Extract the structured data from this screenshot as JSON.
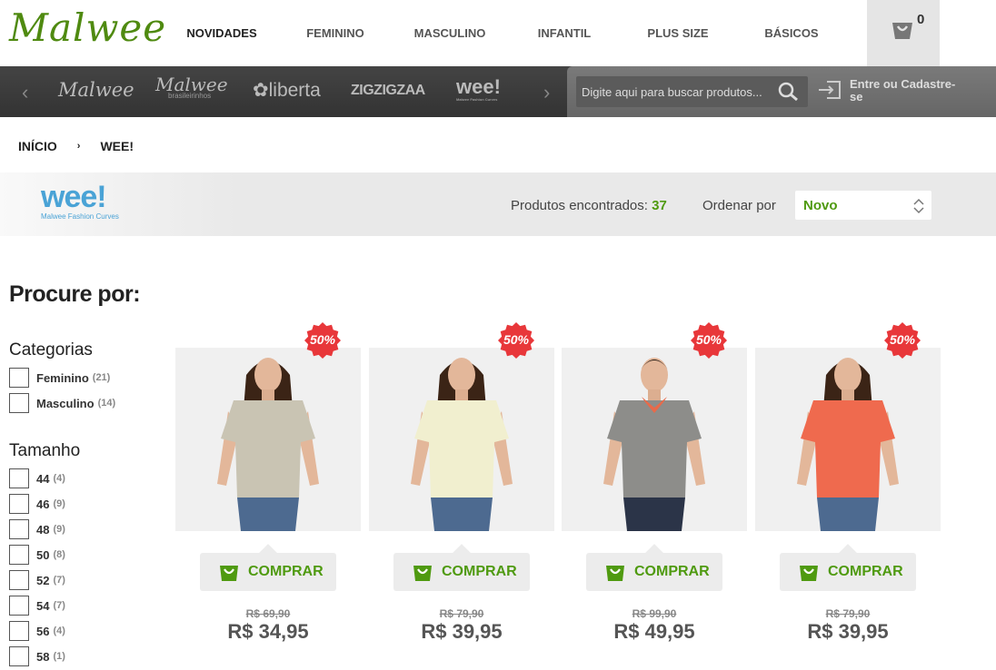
{
  "header": {
    "logo": "Malwee",
    "nav": [
      "NOVIDADES",
      "FEMININO",
      "MASCULINO",
      "INFANTIL",
      "PLUS SIZE",
      "BÁSICOS"
    ],
    "cart_count": "0"
  },
  "brands": {
    "items": [
      {
        "name": "Malwee"
      },
      {
        "name": "Malwee",
        "sub": "brasileirinhos"
      },
      {
        "name": "liberta",
        "sub": "Malwee"
      },
      {
        "name": "ZIGZIGZAA"
      },
      {
        "name": "wee!",
        "sub": "Malwee Fashion Curves"
      }
    ]
  },
  "search": {
    "placeholder": "Digite aqui para buscar produtos..."
  },
  "login": {
    "label": "Entre ou Cadastre-se"
  },
  "breadcrumb": {
    "home": "INÍCIO",
    "separator": "›",
    "current": "WEE!"
  },
  "brand_header": {
    "logo": "wee!",
    "tagline": "Malwee Fashion Curves"
  },
  "listing": {
    "found_label": "Produtos encontrados:",
    "found_count": "37",
    "order_label": "Ordenar por",
    "order_value": "Novo"
  },
  "filters": {
    "title": "Procure por:",
    "categories": {
      "title": "Categorias",
      "items": [
        {
          "label": "Feminino",
          "count": "(21)"
        },
        {
          "label": "Masculino",
          "count": "(14)"
        }
      ]
    },
    "sizes": {
      "title": "Tamanho",
      "items": [
        {
          "label": "44",
          "count": "(4)"
        },
        {
          "label": "46",
          "count": "(9)"
        },
        {
          "label": "48",
          "count": "(9)"
        },
        {
          "label": "50",
          "count": "(8)"
        },
        {
          "label": "52",
          "count": "(7)"
        },
        {
          "label": "54",
          "count": "(7)"
        },
        {
          "label": "56",
          "count": "(4)"
        },
        {
          "label": "58",
          "count": "(1)"
        }
      ]
    }
  },
  "products": [
    {
      "badge": "50%",
      "buy": "COMPRAR",
      "old_price": "R$ 69,90",
      "price": "R$ 34,95",
      "shirt": "#c9c4b3",
      "model": "woman"
    },
    {
      "badge": "50%",
      "buy": "COMPRAR",
      "old_price": "R$ 79,90",
      "price": "R$ 39,95",
      "shirt": "#f1efcf",
      "model": "woman"
    },
    {
      "badge": "50%",
      "buy": "COMPRAR",
      "old_price": "R$ 99,90",
      "price": "R$ 49,95",
      "shirt": "#8d8d8a",
      "model": "man"
    },
    {
      "badge": "50%",
      "buy": "COMPRAR",
      "old_price": "R$ 79,90",
      "price": "R$ 39,95",
      "shirt": "#ef6a4e",
      "model": "woman"
    }
  ],
  "colors": {
    "accent_green": "#4f9a10",
    "sale_red": "#e8373a"
  }
}
